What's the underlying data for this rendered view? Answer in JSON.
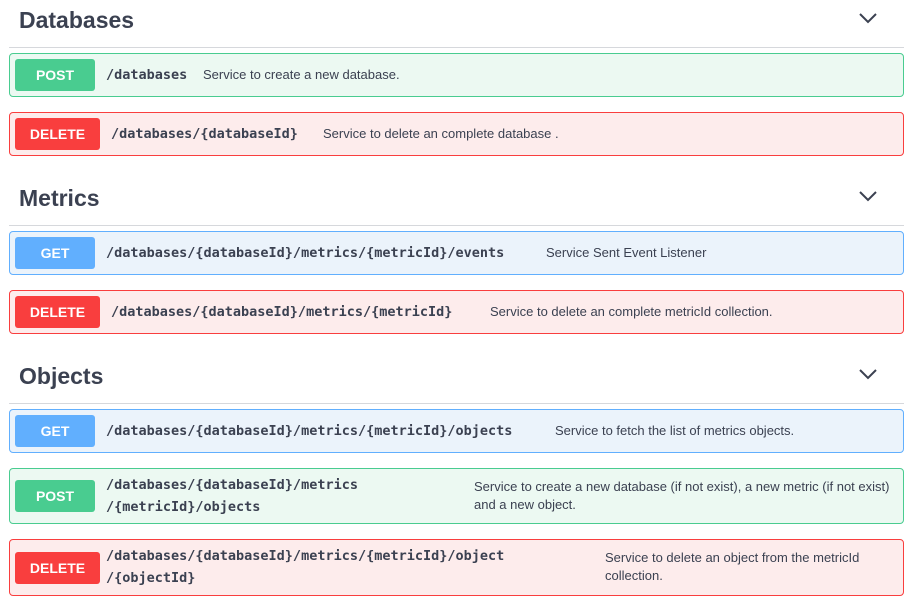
{
  "sections": [
    {
      "title": "Databases",
      "operations": [
        {
          "method": "POST",
          "path": "/databases",
          "description": "Service to create a new database."
        },
        {
          "method": "DELETE",
          "path": "/databases/{databaseId}",
          "description": "Service to delete an complete database ."
        }
      ]
    },
    {
      "title": "Metrics",
      "operations": [
        {
          "method": "GET",
          "path": "/databases/{databaseId}/metrics/{metricId}/events",
          "description": "Service Sent Event Listener"
        },
        {
          "method": "DELETE",
          "path": "/databases/{databaseId}/metrics/{metricId}",
          "description": "Service to delete an complete metricId collection."
        }
      ]
    },
    {
      "title": "Objects",
      "operations": [
        {
          "method": "GET",
          "path": "/databases/{databaseId}/metrics/{metricId}/objects",
          "description": "Service to fetch the list of metrics objects."
        },
        {
          "method": "POST",
          "path_line1": "/databases/{databaseId}/metrics",
          "path_line2": "/{metricId}/objects",
          "description": "Service to create a new database (if not exist), a new metric (if not exist) and a new object."
        },
        {
          "method": "DELETE",
          "path_line1": "/databases/{databaseId}/metrics/{metricId}/object",
          "path_line2": "/{objectId}",
          "description": "Service to delete an object from the metricId collection."
        }
      ]
    }
  ],
  "icons": {
    "section_toggle": "chevron-down-icon"
  },
  "colors": {
    "post": "#49cc90",
    "get": "#61affe",
    "delete": "#f93e3e",
    "text": "#3b4151"
  }
}
